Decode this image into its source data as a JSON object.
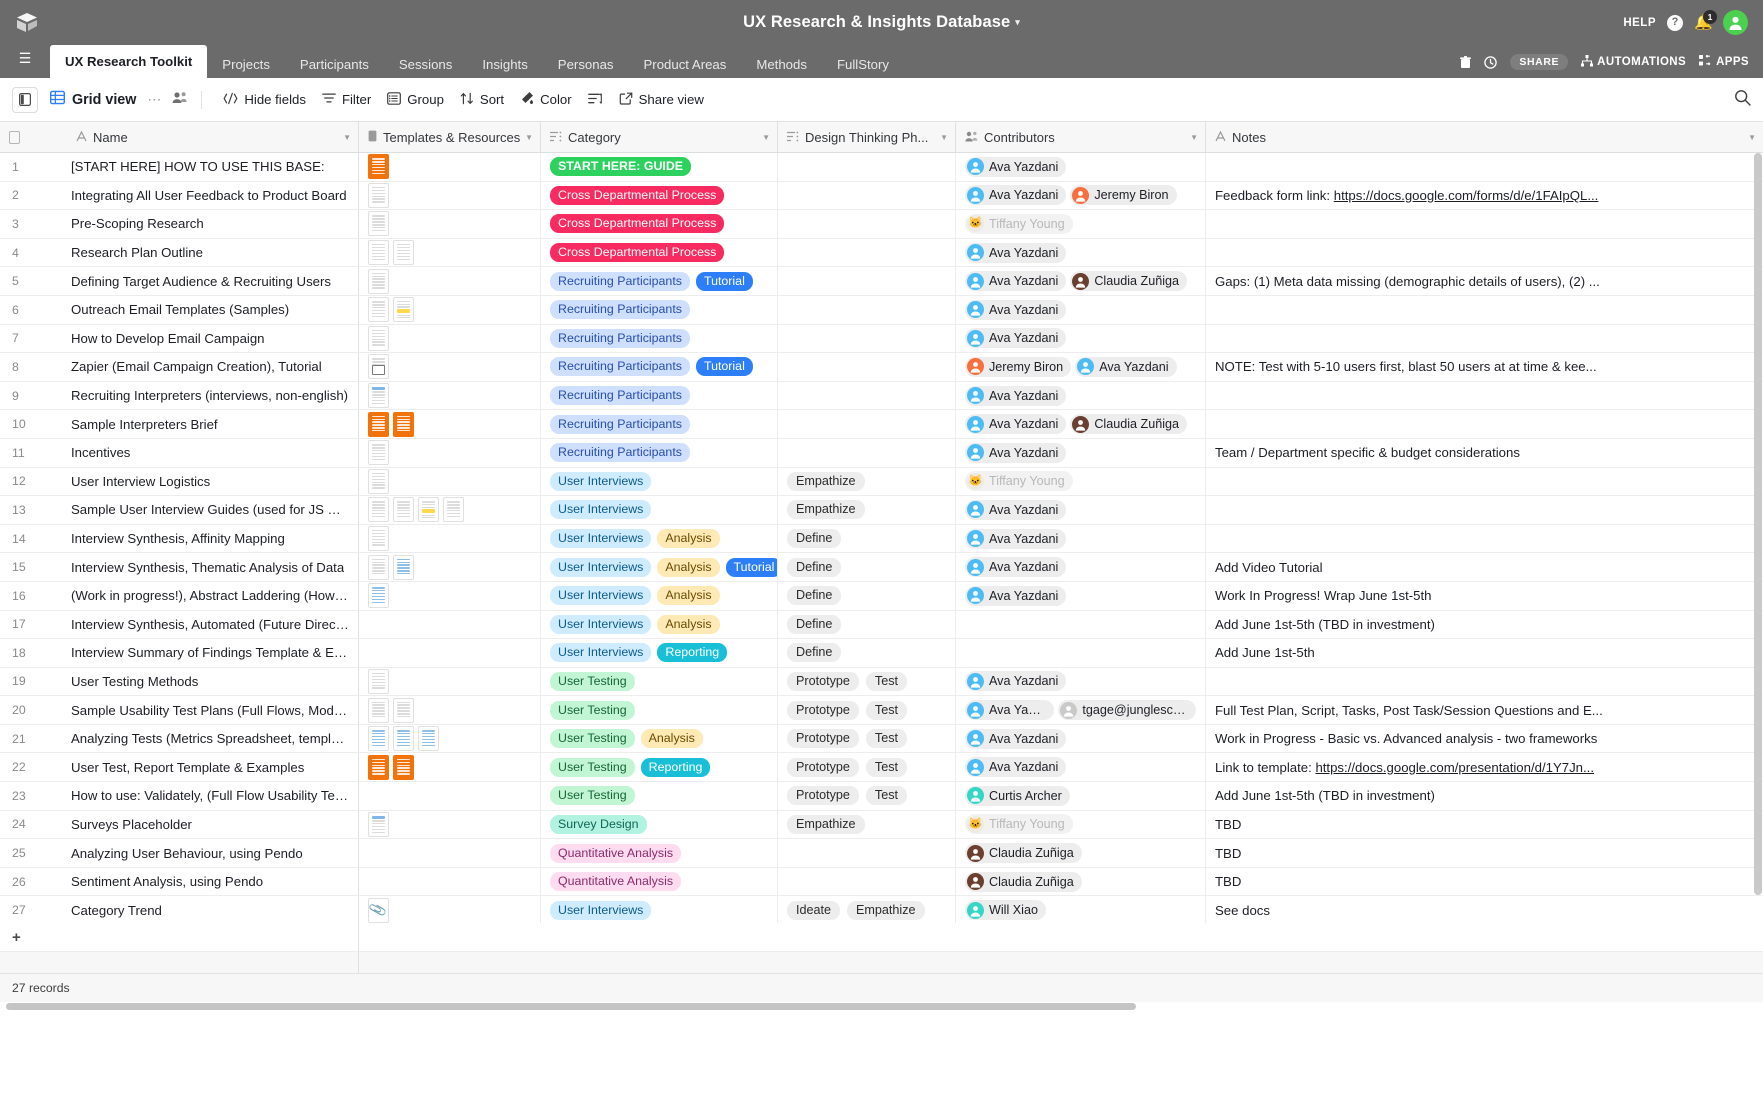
{
  "topbar": {
    "logo_icon": "airtable-logo-icon",
    "base_title": "UX Research & Insights Database",
    "caret": "▾",
    "help_label": "HELP",
    "help_icon": "question-circle-icon",
    "bell_icon": "bell-icon",
    "notification_count": "1",
    "avatar_icon": "user-avatar-icon"
  },
  "tabsbar": {
    "menu_icon": "hamburger-menu-icon",
    "tabs": [
      {
        "label": "UX Research Toolkit",
        "active": true
      },
      {
        "label": "Projects",
        "active": false
      },
      {
        "label": "Participants",
        "active": false
      },
      {
        "label": "Sessions",
        "active": false
      },
      {
        "label": "Insights",
        "active": false
      },
      {
        "label": "Personas",
        "active": false
      },
      {
        "label": "Product Areas",
        "active": false
      },
      {
        "label": "Methods",
        "active": false
      },
      {
        "label": "FullStory",
        "active": false
      }
    ],
    "trash_icon": "trash-icon",
    "history_icon": "history-clock-icon",
    "share_label": "SHARE",
    "automations_label": "AUTOMATIONS",
    "automations_icon": "automations-icon",
    "apps_label": "APPS",
    "apps_icon": "apps-icon"
  },
  "toolbar": {
    "sidebar_toggle_icon": "sidebar-toggle-icon",
    "grid_icon": "grid-view-icon",
    "view_name": "Grid view",
    "more_icon": "more-dots-icon",
    "collaborators_icon": "collaborators-icon",
    "hide_fields": "Hide fields",
    "hide_fields_icon": "hide-fields-icon",
    "filter": "Filter",
    "filter_icon": "filter-icon",
    "group": "Group",
    "group_icon": "group-icon",
    "sort": "Sort",
    "sort_icon": "sort-icon",
    "color": "Color",
    "color_icon": "color-paint-icon",
    "row_height_icon": "row-height-icon",
    "share_view": "Share view",
    "share_view_icon": "share-view-icon",
    "search_icon": "search-icon"
  },
  "grid": {
    "columns": [
      {
        "label": "Name",
        "icon": "text-field-icon"
      },
      {
        "label": "Templates & Resources",
        "icon": "attachment-field-icon"
      },
      {
        "label": "Category",
        "icon": "multiselect-field-icon"
      },
      {
        "label": "Design Thinking Ph...",
        "icon": "multiselect-field-icon"
      },
      {
        "label": "Contributors",
        "icon": "collaborator-field-icon"
      },
      {
        "label": "Notes",
        "icon": "text-field-icon"
      }
    ],
    "add_row_icon": "plus-icon",
    "record_count": "27 records",
    "rows": [
      {
        "n": "1",
        "name": "[START HERE] HOW TO USE THIS BASE:",
        "thumbs": [
          "orange-doc"
        ],
        "category": [
          {
            "t": "START HERE: GUIDE",
            "c": "tag-guide"
          }
        ],
        "phase": [],
        "contributors": [
          {
            "n": "Ava Yazdani",
            "a": "ava"
          }
        ],
        "notes": "",
        "notes_link": ""
      },
      {
        "n": "2",
        "name": "Integrating All User Feedback to Product Board",
        "thumbs": [
          "doc"
        ],
        "category": [
          {
            "t": "Cross Departmental Process",
            "c": "tag-cross"
          }
        ],
        "phase": [],
        "contributors": [
          {
            "n": "Ava Yazdani",
            "a": "ava"
          },
          {
            "n": "Jeremy Biron",
            "a": "jeremy"
          }
        ],
        "notes": "Feedback form link: ",
        "notes_link": "https://docs.google.com/forms/d/e/1FAIpQL..."
      },
      {
        "n": "3",
        "name": "Pre-Scoping Research",
        "thumbs": [
          "doc"
        ],
        "category": [
          {
            "t": "Cross Departmental Process",
            "c": "tag-cross"
          }
        ],
        "phase": [],
        "contributors": [
          {
            "n": "Tiffany Young",
            "a": "cat",
            "muted": true
          }
        ],
        "notes": "",
        "notes_link": ""
      },
      {
        "n": "4",
        "name": "Research Plan Outline",
        "thumbs": [
          "doc",
          "doc"
        ],
        "category": [
          {
            "t": "Cross Departmental Process",
            "c": "tag-cross"
          }
        ],
        "phase": [],
        "contributors": [
          {
            "n": "Ava Yazdani",
            "a": "ava"
          }
        ],
        "notes": "",
        "notes_link": ""
      },
      {
        "n": "5",
        "name": "Defining Target Audience & Recruiting Users",
        "thumbs": [
          "doc"
        ],
        "category": [
          {
            "t": "Recruiting Participants",
            "c": "tag-recruit"
          },
          {
            "t": "Tutorial",
            "c": "tag-tutorial"
          }
        ],
        "phase": [],
        "contributors": [
          {
            "n": "Ava Yazdani",
            "a": "ava"
          },
          {
            "n": "Claudia Zuñiga",
            "a": "claudia"
          }
        ],
        "notes": "Gaps: (1) Meta data missing (demographic details of users), (2) ...",
        "notes_link": ""
      },
      {
        "n": "6",
        "name": "Outreach Email Templates (Samples)",
        "thumbs": [
          "doc",
          "yellow"
        ],
        "category": [
          {
            "t": "Recruiting Participants",
            "c": "tag-recruit"
          }
        ],
        "phase": [],
        "contributors": [
          {
            "n": "Ava Yazdani",
            "a": "ava"
          }
        ],
        "notes": "",
        "notes_link": ""
      },
      {
        "n": "7",
        "name": "How to Develop Email Campaign",
        "thumbs": [
          "doc"
        ],
        "category": [
          {
            "t": "Recruiting Participants",
            "c": "tag-recruit"
          }
        ],
        "phase": [],
        "contributors": [
          {
            "n": "Ava Yazdani",
            "a": "ava"
          }
        ],
        "notes": "",
        "notes_link": ""
      },
      {
        "n": "8",
        "name": "Zapier (Email Campaign Creation), Tutorial",
        "thumbs": [
          "vid"
        ],
        "category": [
          {
            "t": "Recruiting Participants",
            "c": "tag-recruit"
          },
          {
            "t": "Tutorial",
            "c": "tag-tutorial"
          }
        ],
        "phase": [],
        "contributors": [
          {
            "n": "Jeremy Biron",
            "a": "jeremy"
          },
          {
            "n": "Ava Yazdani",
            "a": "ava"
          }
        ],
        "notes": "NOTE: Test with 5-10 users first, blast 50 users at at time & kee...",
        "notes_link": ""
      },
      {
        "n": "9",
        "name": "Recruiting Interpreters (interviews, non-english)",
        "thumbs": [
          "blue"
        ],
        "category": [
          {
            "t": "Recruiting Participants",
            "c": "tag-recruit"
          }
        ],
        "phase": [],
        "contributors": [
          {
            "n": "Ava Yazdani",
            "a": "ava"
          }
        ],
        "notes": "",
        "notes_link": ""
      },
      {
        "n": "10",
        "name": "Sample Interpreters Brief",
        "thumbs": [
          "orange-doc",
          "orange-doc"
        ],
        "category": [
          {
            "t": "Recruiting Participants",
            "c": "tag-recruit"
          }
        ],
        "phase": [],
        "contributors": [
          {
            "n": "Ava Yazdani",
            "a": "ava"
          },
          {
            "n": "Claudia Zuñiga",
            "a": "claudia"
          }
        ],
        "notes": "",
        "notes_link": ""
      },
      {
        "n": "11",
        "name": "Incentives",
        "thumbs": [
          "doc"
        ],
        "category": [
          {
            "t": "Recruiting Participants",
            "c": "tag-recruit"
          }
        ],
        "phase": [],
        "contributors": [
          {
            "n": "Ava Yazdani",
            "a": "ava"
          }
        ],
        "notes": "Team / Department specific & budget considerations",
        "notes_link": ""
      },
      {
        "n": "12",
        "name": "User Interview Logistics",
        "thumbs": [
          "doc"
        ],
        "category": [
          {
            "t": "User Interviews",
            "c": "tag-ui"
          }
        ],
        "phase": [
          "Empathize"
        ],
        "contributors": [
          {
            "n": "Tiffany Young",
            "a": "cat",
            "muted": true
          }
        ],
        "notes": "",
        "notes_link": ""
      },
      {
        "n": "13",
        "name": "Sample User Interview Guides (used for JS Users)",
        "thumbs": [
          "doc",
          "doc",
          "yellow",
          "doc"
        ],
        "category": [
          {
            "t": "User Interviews",
            "c": "tag-ui"
          }
        ],
        "phase": [
          "Empathize"
        ],
        "contributors": [
          {
            "n": "Ava Yazdani",
            "a": "ava"
          }
        ],
        "notes": "",
        "notes_link": ""
      },
      {
        "n": "14",
        "name": "Interview Synthesis, Affinity Mapping",
        "thumbs": [
          "doc"
        ],
        "category": [
          {
            "t": "User Interviews",
            "c": "tag-ui"
          },
          {
            "t": "Analysis",
            "c": "tag-analysis"
          }
        ],
        "phase": [
          "Define"
        ],
        "contributors": [
          {
            "n": "Ava Yazdani",
            "a": "ava"
          }
        ],
        "notes": "",
        "notes_link": ""
      },
      {
        "n": "15",
        "name": "Interview Synthesis, Thematic Analysis of Data",
        "thumbs": [
          "doc",
          "sheet"
        ],
        "category": [
          {
            "t": "User Interviews",
            "c": "tag-ui"
          },
          {
            "t": "Analysis",
            "c": "tag-analysis"
          },
          {
            "t": "Tutorial",
            "c": "tag-tutorial"
          }
        ],
        "phase": [
          "Define"
        ],
        "contributors": [
          {
            "n": "Ava Yazdani",
            "a": "ava"
          }
        ],
        "notes": "Add Video Tutorial",
        "notes_link": ""
      },
      {
        "n": "16",
        "name": "(Work in progress!), Abstract Laddering (How/Why ...",
        "thumbs": [
          "sheet"
        ],
        "category": [
          {
            "t": "User Interviews",
            "c": "tag-ui"
          },
          {
            "t": "Analysis",
            "c": "tag-analysis"
          }
        ],
        "phase": [
          "Define"
        ],
        "contributors": [
          {
            "n": "Ava Yazdani",
            "a": "ava"
          }
        ],
        "notes": "Work In Progress! Wrap June 1st-5th",
        "notes_link": ""
      },
      {
        "n": "17",
        "name": "Interview Synthesis, Automated (Future Direction)",
        "thumbs": [],
        "category": [
          {
            "t": "User Interviews",
            "c": "tag-ui"
          },
          {
            "t": "Analysis",
            "c": "tag-analysis"
          }
        ],
        "phase": [
          "Define"
        ],
        "contributors": [],
        "notes": "Add June 1st-5th (TBD in investment)",
        "notes_link": ""
      },
      {
        "n": "18",
        "name": "Interview Summary of Findings Template & Examples",
        "thumbs": [],
        "category": [
          {
            "t": "User Interviews",
            "c": "tag-ui"
          },
          {
            "t": "Reporting",
            "c": "tag-report"
          }
        ],
        "phase": [
          "Define"
        ],
        "contributors": [],
        "notes": "Add June 1st-5th",
        "notes_link": ""
      },
      {
        "n": "19",
        "name": "User Testing Methods",
        "thumbs": [
          "doc"
        ],
        "category": [
          {
            "t": "User Testing",
            "c": "tag-testing"
          }
        ],
        "phase": [
          "Prototype",
          "Test"
        ],
        "contributors": [
          {
            "n": "Ava Yazdani",
            "a": "ava"
          }
        ],
        "notes": "",
        "notes_link": ""
      },
      {
        "n": "20",
        "name": "Sample Usability Test Plans (Full Flows, Moderated/...",
        "thumbs": [
          "doc",
          "doc"
        ],
        "category": [
          {
            "t": "User Testing",
            "c": "tag-testing"
          }
        ],
        "phase": [
          "Prototype",
          "Test"
        ],
        "contributors": [
          {
            "n": "Ava Yazdani",
            "a": "ava"
          },
          {
            "n": "tgage@junglescout.co",
            "a": "grey"
          }
        ],
        "notes": "Full Test Plan, Script, Tasks, Post Task/Session Questions and E...",
        "notes_link": ""
      },
      {
        "n": "21",
        "name": "Analyzing Tests (Metrics Spreadsheet, templates)",
        "thumbs": [
          "sheet",
          "sheet",
          "sheet"
        ],
        "category": [
          {
            "t": "User Testing",
            "c": "tag-testing"
          },
          {
            "t": "Analysis",
            "c": "tag-analysis"
          }
        ],
        "phase": [
          "Prototype",
          "Test"
        ],
        "contributors": [
          {
            "n": "Ava Yazdani",
            "a": "ava"
          }
        ],
        "notes": "Work in Progress - Basic vs. Advanced analysis - two frameworks",
        "notes_link": ""
      },
      {
        "n": "22",
        "name": "User Test, Report Template & Examples",
        "thumbs": [
          "orange-doc",
          "orange-doc"
        ],
        "category": [
          {
            "t": "User Testing",
            "c": "tag-testing"
          },
          {
            "t": "Reporting",
            "c": "tag-report"
          }
        ],
        "phase": [
          "Prototype",
          "Test"
        ],
        "contributors": [
          {
            "n": "Ava Yazdani",
            "a": "ava"
          }
        ],
        "notes": "Link to template: ",
        "notes_link": "https://docs.google.com/presentation/d/1Y7Jn..."
      },
      {
        "n": "23",
        "name": "How to use: Validately, (Full Flow Usability Testing)",
        "thumbs": [],
        "category": [
          {
            "t": "User Testing",
            "c": "tag-testing"
          }
        ],
        "phase": [
          "Prototype",
          "Test"
        ],
        "contributors": [
          {
            "n": "Curtis Archer",
            "a": "curtis"
          }
        ],
        "notes": "Add June 1st-5th (TBD in investment)",
        "notes_link": ""
      },
      {
        "n": "24",
        "name": "Surveys Placeholder",
        "thumbs": [
          "blue"
        ],
        "category": [
          {
            "t": "Survey Design",
            "c": "tag-survey"
          }
        ],
        "phase": [
          "Empathize"
        ],
        "contributors": [
          {
            "n": "Tiffany Young",
            "a": "cat",
            "muted": true
          }
        ],
        "notes": "TBD",
        "notes_link": ""
      },
      {
        "n": "25",
        "name": "Analyzing User Behaviour, using Pendo",
        "thumbs": [],
        "category": [
          {
            "t": "Quantitative Analysis",
            "c": "tag-quant"
          }
        ],
        "phase": [],
        "contributors": [
          {
            "n": "Claudia Zuñiga",
            "a": "claudia"
          }
        ],
        "notes": "TBD",
        "notes_link": ""
      },
      {
        "n": "26",
        "name": "Sentiment Analysis, using Pendo",
        "thumbs": [],
        "category": [
          {
            "t": "Quantitative Analysis",
            "c": "tag-quant"
          }
        ],
        "phase": [],
        "contributors": [
          {
            "n": "Claudia Zuñiga",
            "a": "claudia"
          }
        ],
        "notes": "TBD",
        "notes_link": ""
      },
      {
        "n": "27",
        "name": "Category Trend",
        "thumbs": [
          "clip"
        ],
        "category": [
          {
            "t": "User Interviews",
            "c": "tag-ui"
          }
        ],
        "phase": [
          "Ideate",
          "Empathize"
        ],
        "contributors": [
          {
            "n": "Will Xiao",
            "a": "will"
          }
        ],
        "notes": "See docs",
        "notes_link": ""
      }
    ]
  },
  "colors": {
    "chrome": "#6b6b6b",
    "accent_blue": "#2d7ff9",
    "avatar_green": "#49d14f"
  }
}
